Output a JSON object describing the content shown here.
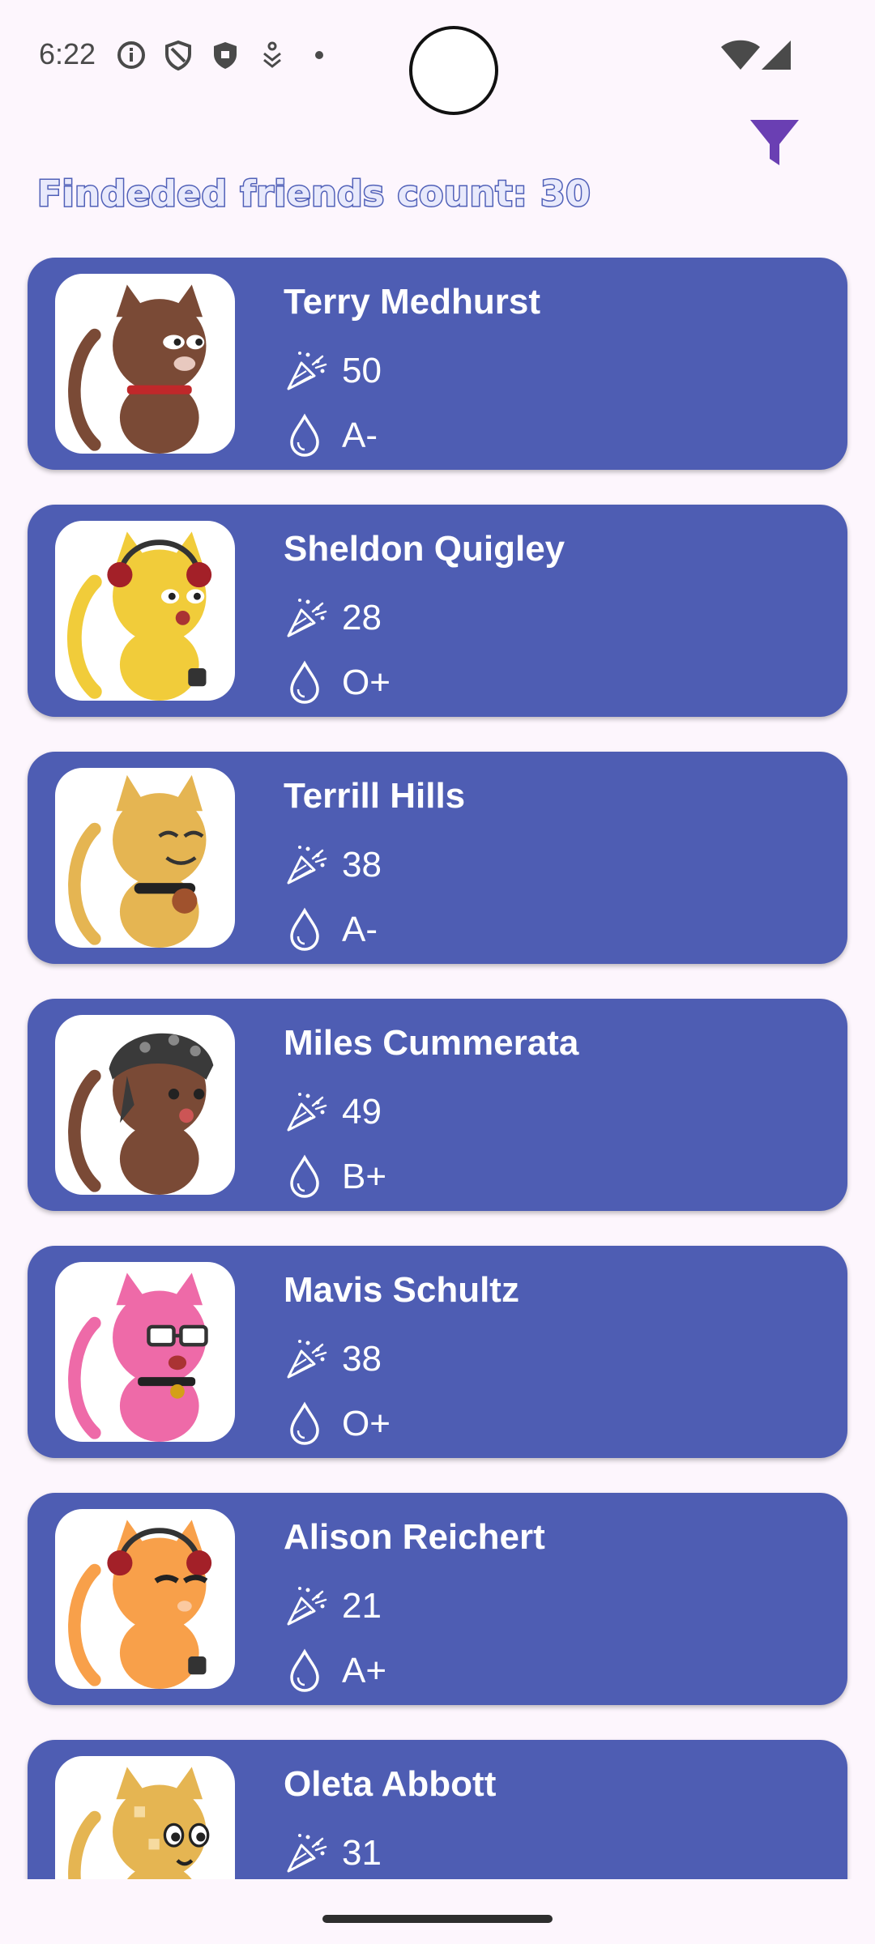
{
  "status_bar": {
    "time": "6:22",
    "icons": [
      "info-icon",
      "shield-icon",
      "shield-filled-icon",
      "download-icon",
      "dot-icon"
    ],
    "right_icons": [
      "wifi-icon",
      "signal-icon"
    ]
  },
  "header": {
    "title": "Findeded friends count: 30",
    "filter_icon": "filter-icon",
    "accent_color": "#6a3fb3"
  },
  "friends": [
    {
      "name": "Terry Medhurst",
      "age": "50",
      "blood": "A-",
      "cat_color": "#7a4a36",
      "accessory": "collar"
    },
    {
      "name": "Sheldon Quigley",
      "age": "28",
      "blood": "O+",
      "cat_color": "#f1cc3a",
      "accessory": "headphones"
    },
    {
      "name": "Terrill Hills",
      "age": "38",
      "blood": "A-",
      "cat_color": "#e5b552",
      "accessory": "collar"
    },
    {
      "name": "Miles Cummerata",
      "age": "49",
      "blood": "B+",
      "cat_color": "#7a4a36",
      "accessory": "bandana"
    },
    {
      "name": "Mavis Schultz",
      "age": "38",
      "blood": "O+",
      "cat_color": "#ee6aa8",
      "accessory": "glasses"
    },
    {
      "name": "Alison Reichert",
      "age": "21",
      "blood": "A+",
      "cat_color": "#f8a04a",
      "accessory": "headphones"
    },
    {
      "name": "Oleta Abbott",
      "age": "31",
      "blood": "",
      "cat_color": "#e5b552",
      "accessory": "none"
    }
  ],
  "colors": {
    "card": "#4e5db3",
    "background": "#fdf6fd",
    "text_on_card": "#ffffff"
  }
}
